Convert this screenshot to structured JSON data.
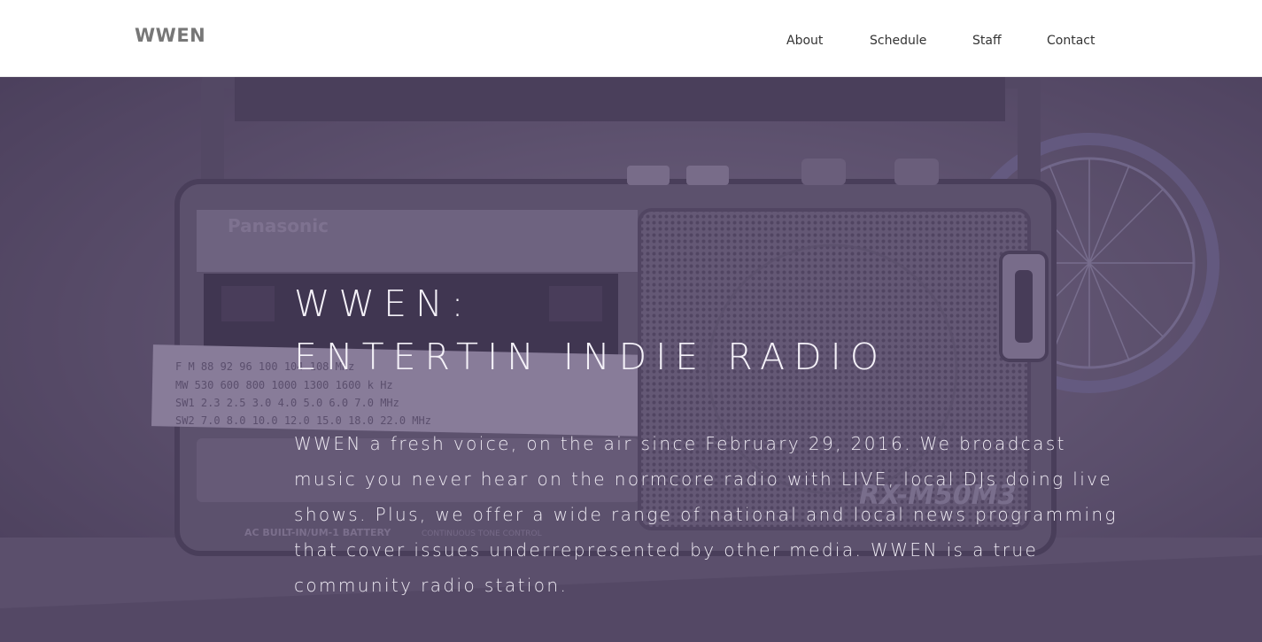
{
  "site": {
    "logo": "WWEN"
  },
  "nav": {
    "items": [
      {
        "label": "About"
      },
      {
        "label": "Schedule"
      },
      {
        "label": "Staff"
      },
      {
        "label": "Contact"
      }
    ]
  },
  "hero": {
    "title_line1": "WWEN:",
    "title_line2": "ENTERTIN INDIE RADIO",
    "description": "WWEN a fresh voice, on the air since February 29, 2016. We broadcast music you never hear on the normcore radio with LIVE, local DJs doing live shows. Plus, we offer a wide range of national and local news programming that cover issues underrepresented by other media. WWEN is a true community radio station.",
    "background": {
      "brand_text": "Panasonic",
      "model_text": "RX-M50M3",
      "battery_text": "AC BUILT-IN/UM-1 BATTERY",
      "tone_text": "CONTINUOUS TONE CONTROL",
      "dial_rows": [
        "F M    88   92   96   100   104   108 MHz",
        "MW    530 600    800 1000  1300 1600 k Hz",
        "SW1   2.3 2.5   3.0    4.0   5.0  6.0  7.0  MHz",
        "SW2    7.0  8.0   10.0 12.0 15.0 18.0  22.0  MHz"
      ]
    }
  },
  "colors": {
    "header_bg": "#ffffff",
    "logo": "#777777",
    "nav_text": "#333333",
    "hero_tint": "#5c4c78",
    "hero_text": "#f4f1f8"
  }
}
